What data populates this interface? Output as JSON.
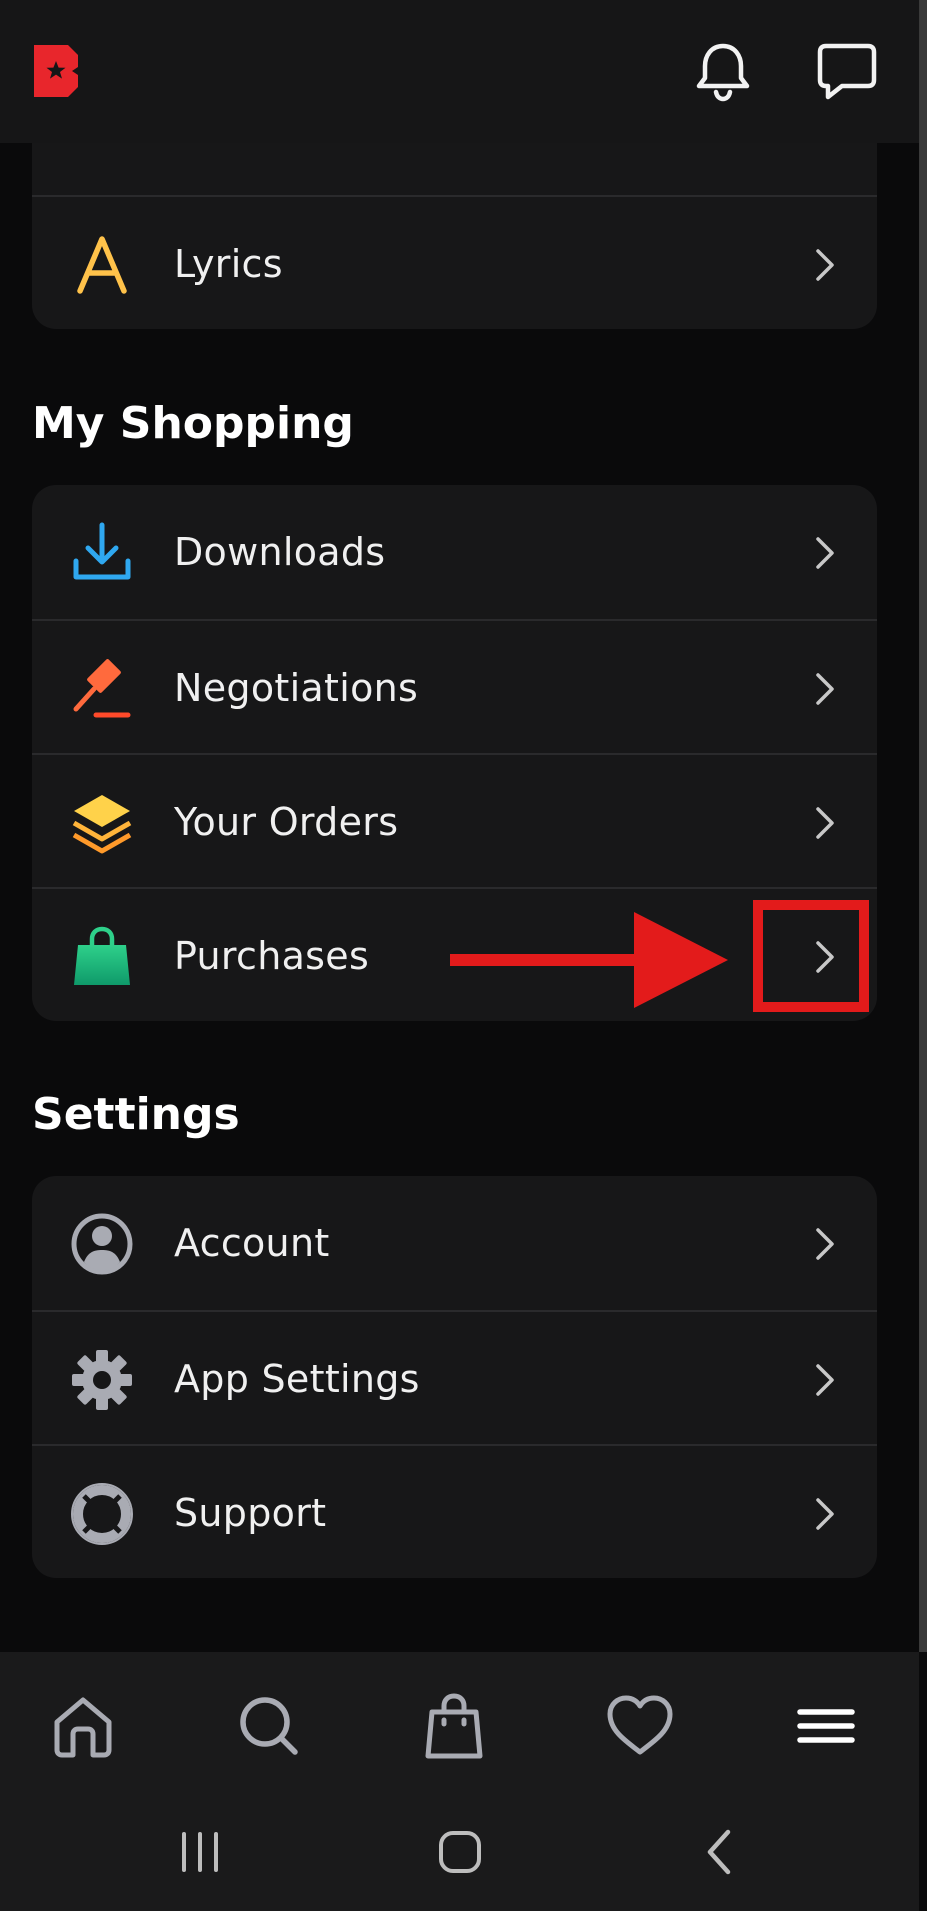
{
  "header": {
    "logo_icon": "beatstars-logo",
    "brand_color": "#e8262c",
    "bell_icon": "bell-icon",
    "chat_icon": "chat-icon"
  },
  "partial_section": {
    "items": [
      {
        "label": "",
        "icon": "guitar-icon"
      },
      {
        "label": "Lyrics",
        "icon": "lyrics-icon"
      }
    ]
  },
  "my_shopping": {
    "title": "My Shopping",
    "items": [
      {
        "label": "Downloads",
        "icon": "download-icon"
      },
      {
        "label": "Negotiations",
        "icon": "gavel-icon"
      },
      {
        "label": "Your Orders",
        "icon": "layers-icon"
      },
      {
        "label": "Purchases",
        "icon": "shopping-bag-icon"
      }
    ]
  },
  "settings": {
    "title": "Settings",
    "items": [
      {
        "label": "Account",
        "icon": "user-circle-icon"
      },
      {
        "label": "App Settings",
        "icon": "gear-icon"
      },
      {
        "label": "Support",
        "icon": "lifebuoy-icon"
      }
    ]
  },
  "annotation": {
    "color": "#e31b1b",
    "target": "Purchases"
  },
  "bottom_nav": {
    "items": [
      "home-icon",
      "search-icon",
      "bag-icon",
      "heart-icon",
      "menu-icon"
    ]
  },
  "system_nav": {
    "items": [
      "recent-apps-icon",
      "home-button-icon",
      "back-icon"
    ]
  }
}
